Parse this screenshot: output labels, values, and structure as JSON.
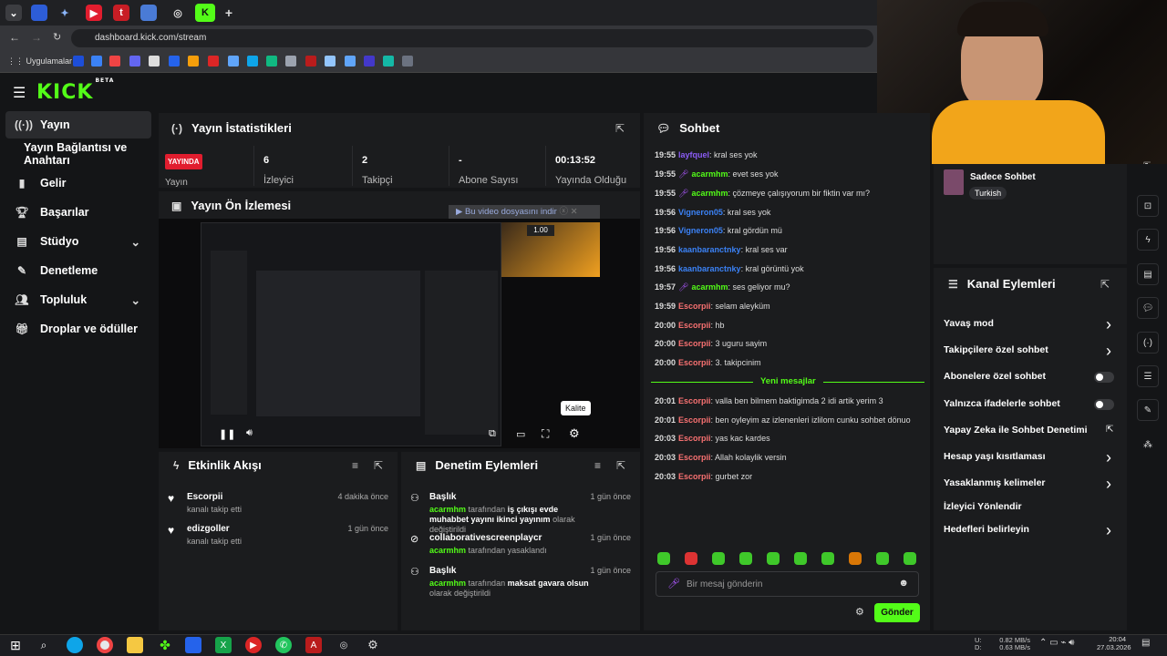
{
  "browser": {
    "url": "dashboard.kick.com/stream",
    "bookmarks_label": "Uygulamalar"
  },
  "brand": {
    "logo": "KICK",
    "beta": "BETA",
    "accent": "#53fc18"
  },
  "sidebar": {
    "items": [
      {
        "label": "Yayın",
        "icon": "broadcast-icon"
      },
      {
        "label": "Yayın Bağlantısı ve Anahtarı",
        "icon": ""
      },
      {
        "label": "Gelir",
        "icon": "chart-icon"
      },
      {
        "label": "Başarılar",
        "icon": "trophy-icon"
      },
      {
        "label": "Stüdyo",
        "icon": "studio-icon"
      },
      {
        "label": "Denetleme",
        "icon": "wrench-icon"
      },
      {
        "label": "Topluluk",
        "icon": "community-icon"
      },
      {
        "label": "Droplar ve ödüller",
        "icon": "gift-icon"
      }
    ]
  },
  "stats": {
    "title": "Yayın İstatistikleri",
    "live_badge": "YAYINDA",
    "stream_label": "Yayın",
    "items": [
      {
        "value": "6",
        "label": "İzleyici"
      },
      {
        "value": "2",
        "label": "Takipçi"
      },
      {
        "value": "-",
        "label": "Abone Sayısı"
      },
      {
        "value": "00:13:52",
        "label": "Yayında Olduğu"
      }
    ]
  },
  "preview": {
    "title": "Yayın Ön İzlemesi",
    "download_label": "Bu video dosyasını indir",
    "speed": "1.00",
    "quality_tooltip": "Kalite"
  },
  "activity": {
    "title": "Etkinlik Akışı",
    "rows": [
      {
        "name": "Escorpii",
        "sub": "kanalı takip etti",
        "time": "4 dakika önce"
      },
      {
        "name": "edizgoller",
        "sub": "kanalı takip etti",
        "time": "1 gün önce"
      }
    ]
  },
  "moderation": {
    "title": "Denetim Eylemleri",
    "rows": [
      {
        "name": "Başlık",
        "actor": "acarmhm",
        "mid": "tarafından",
        "target": "iş çıkışı evde muhabbet yayını ikinci yayınım",
        "tail": "olarak değiştirildi",
        "time": "1 gün önce"
      },
      {
        "name": "collaborativescreenplaycr",
        "actor": "acarmhm",
        "mid": "tarafından yasaklandı",
        "target": "",
        "tail": "",
        "time": "1 gün önce"
      },
      {
        "name": "Başlık",
        "actor": "acarmhm",
        "mid": "tarafından",
        "target": "maksat gavara olsun",
        "tail": "olarak değiştirildi",
        "time": "1 gün önce"
      }
    ]
  },
  "chat": {
    "title": "Sohbet",
    "new_messages": "Yeni mesajlar",
    "placeholder": "Bir mesaj gönderin",
    "send_label": "Gönder",
    "messages": [
      {
        "time": "19:55",
        "user": "layfquel",
        "color": "#8b5cf6",
        "text": ": kral ses yok"
      },
      {
        "time": "19:55",
        "user": "acarmhm",
        "color": "#53fc18",
        "text": ": evet ses yok",
        "mic": true
      },
      {
        "time": "19:55",
        "user": "acarmhm",
        "color": "#53fc18",
        "text": ": çözmeye çalışıyorum bir fiktin var mı?",
        "mic": true
      },
      {
        "time": "19:56",
        "user": "Vigneron05",
        "color": "#3b82f6",
        "text": ": kral ses yok"
      },
      {
        "time": "19:56",
        "user": "Vigneron05",
        "color": "#3b82f6",
        "text": ": kral gördün mü"
      },
      {
        "time": "19:56",
        "user": "kaanbaranctnky",
        "color": "#3b82f6",
        "text": ": kral ses var"
      },
      {
        "time": "19:56",
        "user": "kaanbaranctnky",
        "color": "#3b82f6",
        "text": ": kral görüntü yok"
      },
      {
        "time": "19:57",
        "user": "acarmhm",
        "color": "#53fc18",
        "text": ": ses geliyor mu?",
        "mic": true
      },
      {
        "time": "19:59",
        "user": "Escorpii",
        "color": "#f87171",
        "text": ": selam aleyküm"
      },
      {
        "time": "20:00",
        "user": "Escorpii",
        "color": "#f87171",
        "text": ": hb"
      },
      {
        "time": "20:00",
        "user": "Escorpii",
        "color": "#f87171",
        "text": ": 3 uguru sayim"
      },
      {
        "time": "20:00",
        "user": "Escorpii",
        "color": "#f87171",
        "text": ": 3. takipcinim"
      },
      {
        "time": "20:01",
        "user": "Escorpii",
        "color": "#f87171",
        "text": ": valla ben bilmem baktigimda 2 idi artik yerim 3"
      },
      {
        "time": "20:01",
        "user": "Escorpii",
        "color": "#f87171",
        "text": ": ben oyleyim az izlenenleri izlilom cunku sohbet dönuo"
      },
      {
        "time": "20:03",
        "user": "Escorpii",
        "color": "#f87171",
        "text": ": yas kac kardes"
      },
      {
        "time": "20:03",
        "user": "Escorpii",
        "color": "#f87171",
        "text": ": Allah kolaylik versin"
      },
      {
        "time": "20:03",
        "user": "Escorpii",
        "color": "#f87171",
        "text": ": gurbet zor"
      }
    ]
  },
  "chat_mode": {
    "title": "Sadece Sohbet",
    "tag": "Turkish"
  },
  "channel_actions": {
    "title": "Kanal Eylemleri",
    "items": [
      {
        "label": "Yavaş mod",
        "control": "chevron"
      },
      {
        "label": "Takipçilere özel sohbet",
        "control": "chevron"
      },
      {
        "label": "Abonelere özel sohbet",
        "control": "toggle"
      },
      {
        "label": "Yalnızca ifadelerle sohbet",
        "control": "toggle"
      },
      {
        "label": "Yapay Zeka ile Sohbet Denetimi",
        "control": "external"
      },
      {
        "label": "Hesap yaşı kısıtlaması",
        "control": "chevron"
      },
      {
        "label": "Yasaklanmış kelimeler",
        "control": "chevron"
      },
      {
        "label": "İzleyici Yönlendir",
        "control": "none"
      },
      {
        "label": "Hedefleri belirleyin",
        "control": "chevron"
      }
    ]
  },
  "taskbar": {
    "net_up": "0.82 MB/s",
    "net_down": "0.63 MB/s",
    "net_labels": "U:\nD:",
    "time": "20:04",
    "date": "27.03.2026"
  }
}
